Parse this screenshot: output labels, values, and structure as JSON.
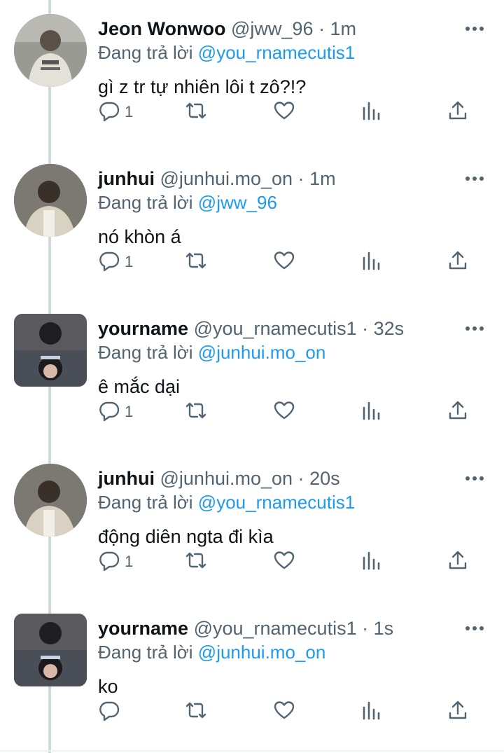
{
  "reply_prefix": "Đang trả lời",
  "icons": {
    "more": "more-dots-icon",
    "reply": "reply-bubble-icon",
    "retweet": "retweet-icon",
    "like": "heart-icon",
    "stats": "stats-bars-icon",
    "share": "share-icon"
  },
  "colors": {
    "link": "#1d9bf0",
    "secondary": "#536471",
    "text": "#0f1419"
  },
  "tweets": [
    {
      "name": "Jeon Wonwoo",
      "handle": "@jww_96",
      "dot": "·",
      "time": "1m",
      "reply_to": "@you_rnamecutis1",
      "text": "gì z tr tự nhiên lôi t zô?!?",
      "reply_count": "1"
    },
    {
      "name": "junhui",
      "handle": "@junhui.mo_on",
      "dot": "·",
      "time": "1m",
      "reply_to": "@jww_96",
      "text": "nó khòn á",
      "reply_count": "1"
    },
    {
      "name": "yourname",
      "handle": "@you_rnamecutis1",
      "dot": "·",
      "time": "32s",
      "reply_to": "@junhui.mo_on",
      "text": "ê mắc dại",
      "reply_count": "1"
    },
    {
      "name": "junhui",
      "handle": "@junhui.mo_on",
      "dot": "·",
      "time": "20s",
      "reply_to": "@you_rnamecutis1",
      "text": "động diên ngta đi kìa",
      "reply_count": "1"
    },
    {
      "name": "yourname",
      "handle": "@you_rnamecutis1",
      "dot": "·",
      "time": "1s",
      "reply_to": "@junhui.mo_on",
      "text": "ko",
      "reply_count": ""
    }
  ]
}
